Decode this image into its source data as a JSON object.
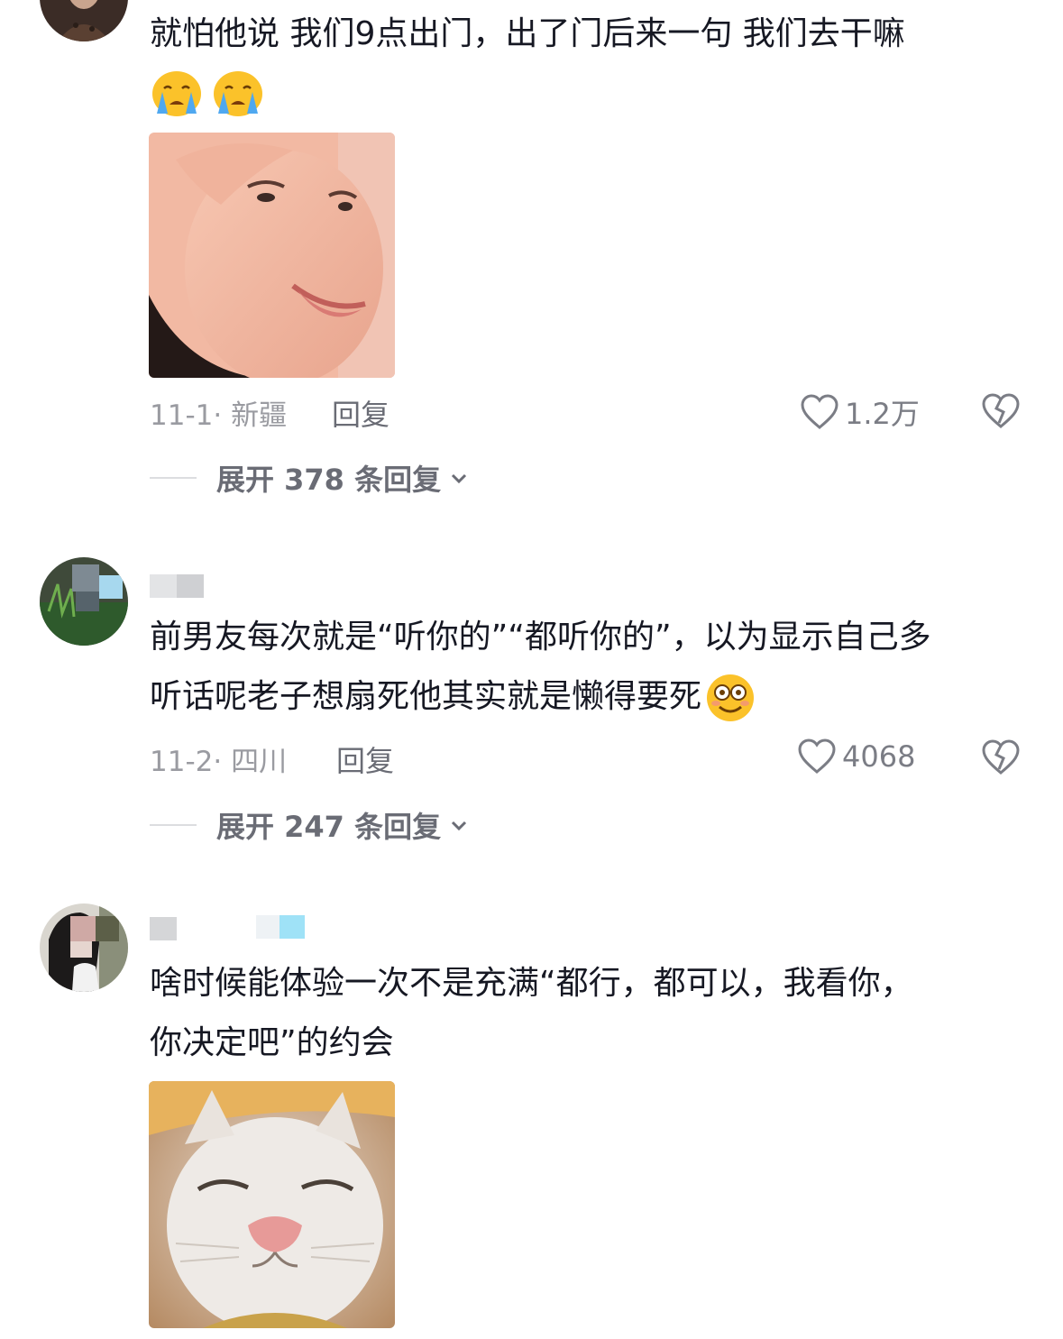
{
  "comments": [
    {
      "text_line1": "就怕他说 我们9点出门，出了门后来一句  我们去干嘛",
      "emojis": [
        "crying-face",
        "crying-face"
      ],
      "date": "11-1",
      "location": "新疆",
      "reply_label": "回复",
      "likes": "1.2万",
      "expand_label": "展开 378 条回复"
    },
    {
      "text_line1": "前男友每次就是“听你的”“都听你的”，以为显示自己多",
      "text_line2": "听话呢老子想扇死他其实就是懒得要死",
      "emojis": [
        "dizzy-smile-face"
      ],
      "date": "11-2",
      "location": "四川",
      "reply_label": "回复",
      "likes": "4068",
      "expand_label": "展开 247 条回复"
    },
    {
      "text_line1": "啥时候能体验一次不是充满“都行，都可以，我看你，",
      "text_line2": "你决定吧”的约会"
    }
  ],
  "colors": {
    "text": "#161823",
    "meta": "#9a9ba1",
    "action": "#6a6c75"
  },
  "icons": [
    "heart-outline-icon",
    "broken-heart-icon",
    "chevron-down-icon"
  ]
}
